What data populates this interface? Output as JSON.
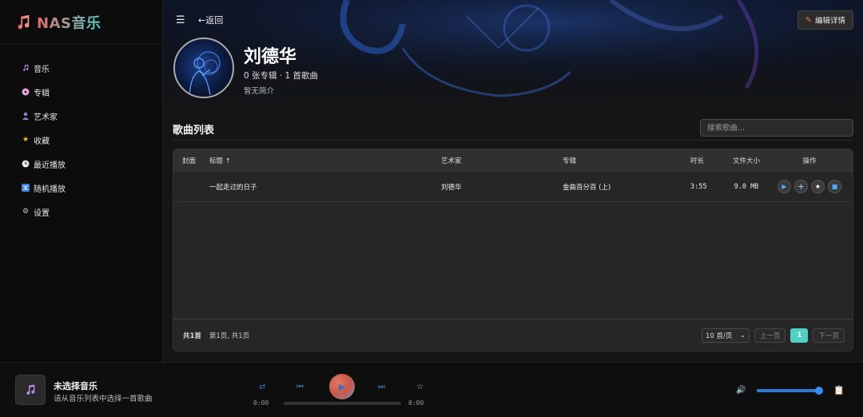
{
  "brand": {
    "name": "NAS音乐"
  },
  "nav": [
    {
      "label": "音乐",
      "icon": "music-note-icon"
    },
    {
      "label": "专辑",
      "icon": "disc-icon"
    },
    {
      "label": "艺术家",
      "icon": "person-icon"
    },
    {
      "label": "收藏",
      "icon": "star-icon"
    },
    {
      "label": "最近播放",
      "icon": "clock-icon"
    },
    {
      "label": "随机播放",
      "icon": "shuffle-icon"
    },
    {
      "label": "设置",
      "icon": "gear-icon"
    }
  ],
  "topbar": {
    "menu_glyph": "☰",
    "back_label": "←返回",
    "edit_label": "编辑详情"
  },
  "artist": {
    "name": "刘德华",
    "stats": "0 张专辑 · 1 首歌曲",
    "intro": "暂无简介"
  },
  "songs": {
    "section_title": "歌曲列表",
    "search_placeholder": "搜索歌曲...",
    "columns": {
      "cover": "封面",
      "title": "标题 ↑",
      "artist": "艺术家",
      "album": "专辑",
      "duration": "时长",
      "size": "文件大小",
      "ops": "操作"
    },
    "rows": [
      {
        "title": "一起走过的日子",
        "artist": "刘德华",
        "album": "金曲百分百 (上)",
        "duration": "3:55",
        "size": "9.0 MB"
      }
    ],
    "footer": {
      "total": "共1首",
      "page_info": "第1页, 共1页",
      "page_size": "10 首/页",
      "prev": "上一页",
      "current_page": "1",
      "next": "下一页"
    }
  },
  "player": {
    "title": "未选择音乐",
    "subtitle": "请从音乐列表中选择一首歌曲",
    "time_current": "0:00",
    "time_total": "0:00",
    "progress": 0,
    "volume": 1.0
  },
  "colors": {
    "accent": "#4fd0c5",
    "brand_red": "#e36a6a",
    "blue": "#2a7bd8"
  }
}
